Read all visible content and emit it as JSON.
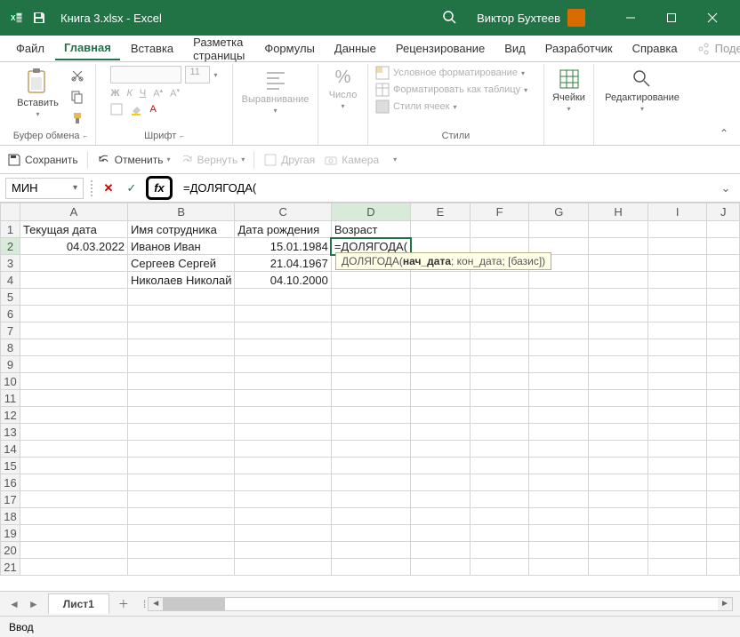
{
  "titlebar": {
    "title": "Книга 3.xlsx  -  Excel",
    "user": "Виктор Бухтеев"
  },
  "tabs": {
    "file": "Файл",
    "home": "Главная",
    "insert": "Вставка",
    "layout": "Разметка страницы",
    "formulas": "Формулы",
    "data": "Данные",
    "review": "Рецензирование",
    "view": "Вид",
    "developer": "Разработчик",
    "help": "Справка",
    "share": "Поделиться"
  },
  "ribbon": {
    "paste": "Вставить",
    "clipboard": "Буфер обмена",
    "font": "Шрифт",
    "fontSize": "11",
    "alignment": "Выравнивание",
    "number": "Число",
    "percent": "%",
    "condfmt": "Условное форматирование",
    "fmttable": "Форматировать как таблицу",
    "cellstyles": "Стили ячеек",
    "styles": "Стили",
    "cells": "Ячейки",
    "editing": "Редактирование"
  },
  "qtb": {
    "save": "Сохранить",
    "undo": "Отменить",
    "redo": "Вернуть",
    "other": "Другая",
    "camera": "Камера"
  },
  "formula": {
    "namebox": "МИН",
    "value": "=ДОЛЯГОДА(",
    "tooltip_fn": "ДОЛЯГОДА(",
    "tooltip_arg1": "нач_дата",
    "tooltip_rest": "; кон_дата; [базис])"
  },
  "cols": [
    "A",
    "B",
    "C",
    "D",
    "E",
    "F",
    "G",
    "H",
    "I",
    "J"
  ],
  "rows": [
    "1",
    "2",
    "3",
    "4",
    "5",
    "6",
    "7",
    "8",
    "9",
    "10",
    "11",
    "12",
    "13",
    "14",
    "15",
    "16",
    "17",
    "18",
    "19",
    "20",
    "21"
  ],
  "cells": {
    "A1": "Текущая дата",
    "B1": "Имя сотрудника",
    "C1": "Дата рождения",
    "D1": "Возраст",
    "A2": "04.03.2022",
    "B2": "Иванов Иван",
    "C2": "15.01.1984",
    "D2": "=ДОЛЯГОДА(",
    "B3": "Сергеев Сергей",
    "C3": "21.04.1967",
    "B4": "Николаев Николай",
    "C4": "04.10.2000"
  },
  "sheet": {
    "tab": "Лист1",
    "status": "Ввод"
  }
}
